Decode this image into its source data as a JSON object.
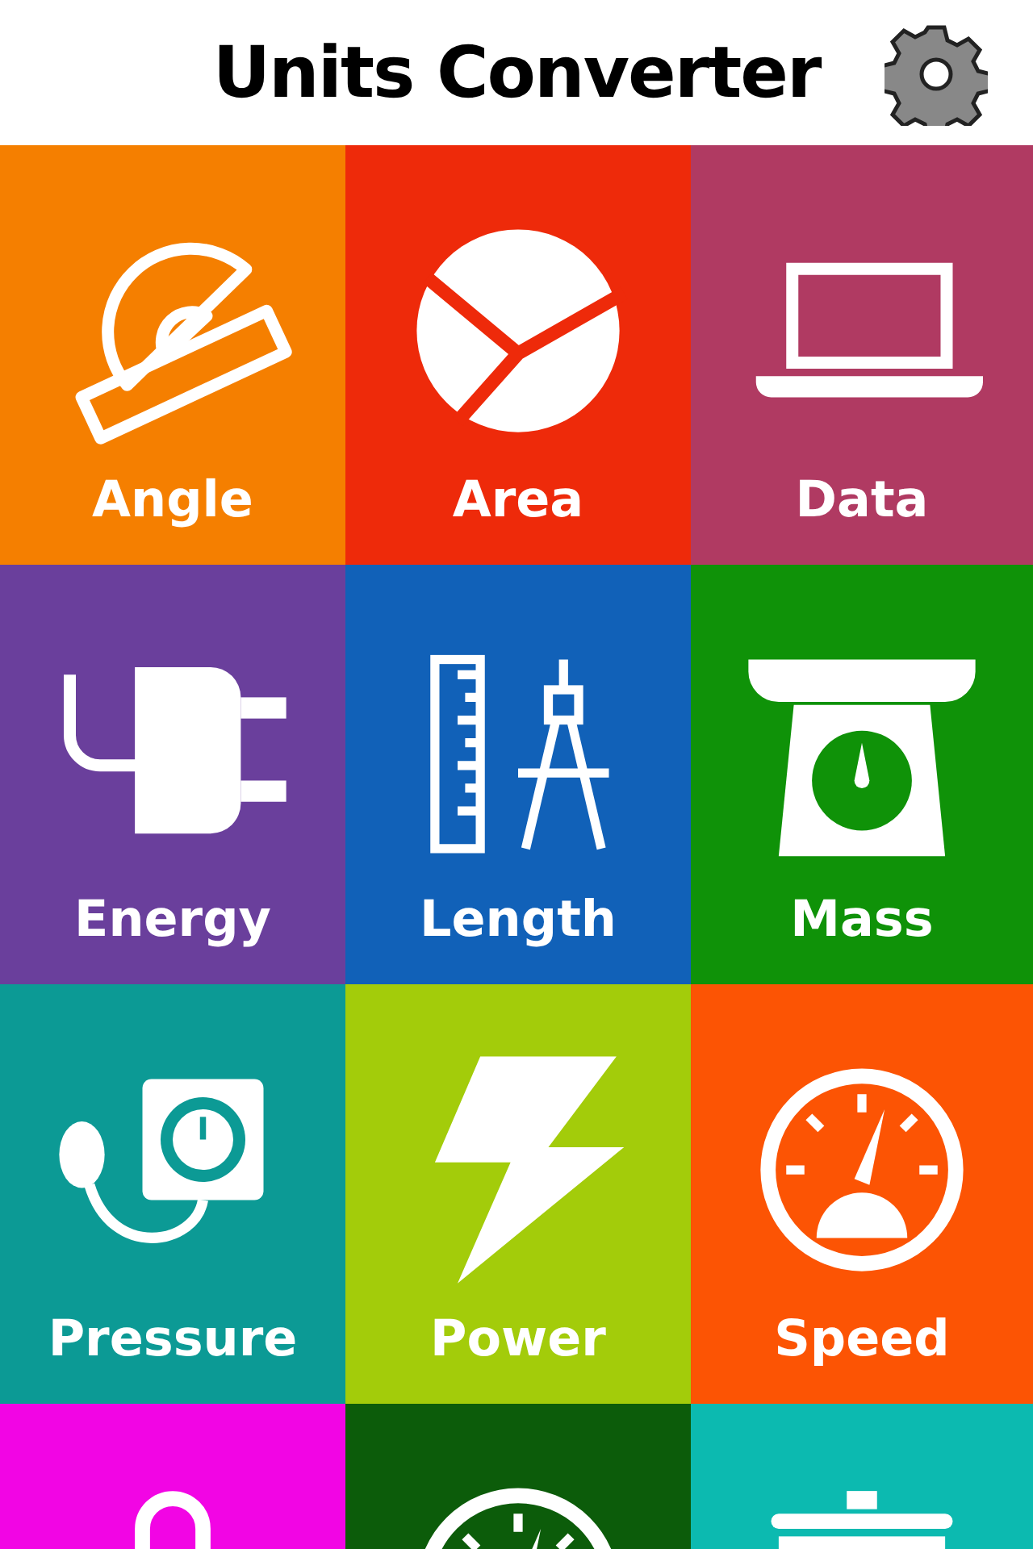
{
  "header": {
    "title": "Units Converter"
  },
  "tiles": [
    {
      "label": "Angle",
      "color": "#f57f00",
      "kind": "protractor"
    },
    {
      "label": "Area",
      "color": "#ee2a0a",
      "kind": "pie"
    },
    {
      "label": "Data",
      "color": "#b03a62",
      "kind": "laptop"
    },
    {
      "label": "Energy",
      "color": "#6a3f9c",
      "kind": "plug"
    },
    {
      "label": "Length",
      "color": "#1161b8",
      "kind": "ruler"
    },
    {
      "label": "Mass",
      "color": "#0f9208",
      "kind": "scale"
    },
    {
      "label": "Pressure",
      "color": "#0c9a95",
      "kind": "gauge"
    },
    {
      "label": "Power",
      "color": "#a3cc0a",
      "kind": "bolt"
    },
    {
      "label": "Speed",
      "color": "#fc5404",
      "kind": "speedometer"
    },
    {
      "color": "#f205e4",
      "kind": "thermometer"
    },
    {
      "color": "#0c5c0a",
      "kind": "dial"
    },
    {
      "color": "#0cbab0",
      "kind": "pot"
    }
  ]
}
